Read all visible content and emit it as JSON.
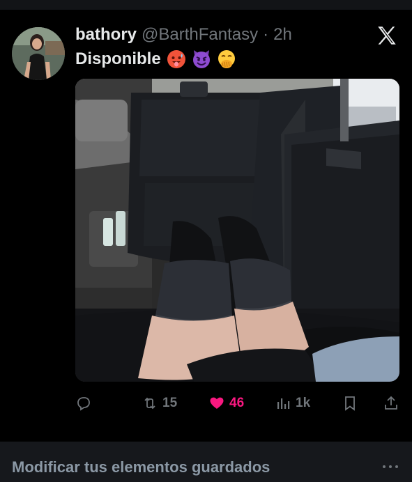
{
  "tweet": {
    "author": {
      "display_name": "bathory",
      "handle": "@BarthFantasy",
      "separator": "·",
      "time": "2h"
    },
    "text": "Disponible",
    "emojis": [
      "hot-face-emoji",
      "smiling-face-with-horns-emoji",
      "face-with-hand-over-mouth-emoji"
    ],
    "actions": {
      "reply_count": "",
      "retweet_count": "15",
      "like_count": "46",
      "views_count": "1k"
    },
    "liked": true
  },
  "footer": {
    "label": "Modificar tus elementos guardados"
  },
  "colors": {
    "background": "#000000",
    "secondary_text": "#71767b",
    "like_pink": "#f91880",
    "footer_bg": "#16181c"
  }
}
